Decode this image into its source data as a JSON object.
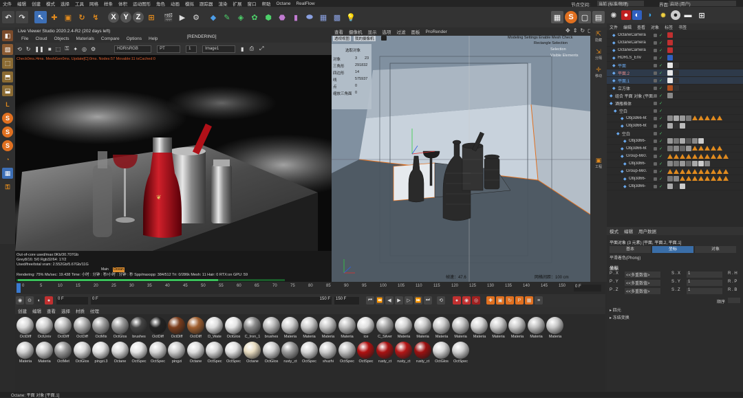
{
  "menubar": {
    "items": [
      "文件",
      "编辑",
      "创建",
      "模式",
      "选择",
      "工具",
      "网格",
      "样条",
      "体积",
      "运动图形",
      "角色",
      "动画",
      "模拟",
      "跟踪器",
      "渲染",
      "扩展",
      "窗口",
      "帮助",
      "Octane",
      "RealFlow"
    ],
    "node_space_label": "节点空间:",
    "node_space_value": "当前 (标准/物理)",
    "layout_label": "界面:",
    "layout_value": "启动 (用户)"
  },
  "toolbar": {
    "axis_x": "X",
    "axis_y": "Y",
    "axis_z": "Z"
  },
  "live_viewer": {
    "title": "Live Viewer Studio 2020.2.4-R2 (202 days left)",
    "menu": [
      "File",
      "Cloud",
      "Objects",
      "Materials",
      "Compare",
      "Options",
      "Help"
    ],
    "state": "[RENDERING]",
    "color_space": "HDR/sRGB",
    "kernel": "PT",
    "index": "1",
    "pass": "Image1",
    "check_line": "Check0ms./4ms. MeshGen0ms. Update[C]:0ms. Nodes:57 Movable:11 txCached:0",
    "status": {
      "line1": "Out-of-core used/max:0Kb/30.707Gb",
      "line2": "Grey8/16: 5/0          Rgb32/64: 17/2",
      "line3": "Used/free/total vram: 2.552Gb/5.67Gb/11G",
      "line4_rendering": "Rendering: 75%  Ms/sec: 19.438  Time: 小时 : 分钟 : 秒/小时 : 分钟 : 秒  Spp/maxspp: 384/512  Tri: 0/286k  Mesh: 11  Hair: 0  RTX:on  GPU: 59",
      "main_label": "Main",
      "main_sub": "Ocean"
    }
  },
  "viewport": {
    "menu": [
      "查看",
      "摄像机",
      "显示",
      "选项",
      "过滤",
      "面板",
      "ProRender"
    ],
    "label_view": "透视视图",
    "label_camera": "我的摄像机",
    "info_top": "Modeling Settings Enable Mesh Check",
    "info_rect": "Rectangle Selection",
    "info_ion": "Selection",
    "info_vis": "Visible Elements",
    "stats_title": "选取对象",
    "stats": [
      {
        "k": "对象",
        "v": "3",
        "v2": "23"
      },
      {
        "k": "三角形",
        "v": "291832"
      },
      {
        "k": "四边形",
        "v": "14"
      },
      {
        "k": "线",
        "v": "575937"
      },
      {
        "k": "点",
        "v": "0"
      },
      {
        "k": "缩放三角面",
        "v": "0"
      }
    ],
    "speed": "帧速：47.6",
    "grid": "网格间距：100 cm"
  },
  "vp_side": {
    "items": [
      "隐藏",
      "分隔",
      "移动",
      "工程"
    ]
  },
  "object_manager": {
    "menu": [
      "文件",
      "编辑",
      "查看",
      "对象",
      "标签",
      "书签"
    ],
    "rows": [
      {
        "name": "OctaneCamera",
        "indent": 8,
        "color": "#cfcfcf"
      },
      {
        "name": "OctaneCamera",
        "indent": 8,
        "color": "#cfcfcf"
      },
      {
        "name": "OctaneCamera",
        "indent": 8,
        "color": "#cfcfcf"
      },
      {
        "name": "HDRLS_Env",
        "indent": 8,
        "color": "#cfcfcf"
      },
      {
        "name": "平面",
        "indent": 8,
        "color": "#6aaaf0"
      },
      {
        "name": "平面.2",
        "indent": 8,
        "color": "#e58c8c"
      },
      {
        "name": "平面.1",
        "indent": 8,
        "color": "#6aaaf0"
      },
      {
        "name": "立方体",
        "indent": 8,
        "color": "#cfcfcf"
      },
      {
        "name": "组合 平面 对象 (平面.1)",
        "indent": 4,
        "color": "#cfcfcf"
      },
      {
        "name": "酒瓶格体",
        "indent": 4,
        "color": "#cfcfcf"
      },
      {
        "name": "空白",
        "indent": 10,
        "color": "#cfcfcf"
      },
      {
        "name": "Obj3d66-6t",
        "indent": 20,
        "color": "#cfcfcf"
      },
      {
        "name": "Obj3d66-6t",
        "indent": 20,
        "color": "#cfcfcf"
      },
      {
        "name": "空白",
        "indent": 14,
        "color": "#cfcfcf"
      },
      {
        "name": "Obj3d66-",
        "indent": 24,
        "color": "#cfcfcf"
      },
      {
        "name": "Obj3d66-6t",
        "indent": 20,
        "color": "#cfcfcf"
      },
      {
        "name": "Group-660.",
        "indent": 20,
        "color": "#cfcfcf"
      },
      {
        "name": "Obj3d66-",
        "indent": 24,
        "color": "#cfcfcf"
      },
      {
        "name": "Group-660.",
        "indent": 20,
        "color": "#cfcfcf"
      },
      {
        "name": "Obj3d66-",
        "indent": 24,
        "color": "#cfcfcf"
      },
      {
        "name": "Obj3d66-",
        "indent": 24,
        "color": "#cfcfcf"
      }
    ]
  },
  "attribute_manager": {
    "menu": [
      "模式",
      "编辑",
      "用户数据"
    ],
    "title": "平面对象 (3 元素) [平面, 平面.2, 平面.1]",
    "tabs": [
      "基本",
      "坐标",
      "对象"
    ],
    "phong": "平滑着色(Phong)",
    "section": "坐标",
    "coords": [
      {
        "a": "P . X",
        "v": "<<多重数值>",
        "b": "S . X",
        "bv": "1",
        "c": "R . H"
      },
      {
        "a": "P . Y",
        "v": "<<多重数值>",
        "b": "S . Y",
        "bv": "1",
        "c": "R . P"
      },
      {
        "a": "P . Z",
        "v": "<<多重数值>",
        "b": "S . Z",
        "bv": "1",
        "c": "R . B"
      }
    ],
    "order": "顺序",
    "quat": "四元",
    "freeze": "冻结变换"
  },
  "timeline": {
    "ticks": [
      "0",
      "5",
      "10",
      "15",
      "20",
      "25",
      "30",
      "35",
      "40",
      "45",
      "50",
      "55",
      "60",
      "65",
      "70",
      "75",
      "80",
      "85",
      "90",
      "95",
      "100",
      "105",
      "110",
      "115",
      "120",
      "125",
      "130",
      "135",
      "140",
      "145",
      "150"
    ],
    "current": "0 F"
  },
  "transport": {
    "start": "0 F",
    "cur": "0 F",
    "end": "150 F",
    "end2": "150 F"
  },
  "material_manager": {
    "menu": [
      "创建",
      "编辑",
      "查看",
      "选择",
      "材质",
      "纹理"
    ],
    "row1": [
      {
        "n": "OctDiff",
        "c": "#d8d8d8"
      },
      {
        "n": "OctUniv",
        "c": "#cfcfcf"
      },
      {
        "n": "OctDiff",
        "c": "#bdbdbd"
      },
      {
        "n": "OctDiff",
        "c": "#b0b0b0"
      },
      {
        "n": "OctMix",
        "c": "#a0a0a0"
      },
      {
        "n": "OctGlos",
        "c": "#9a9a9a"
      },
      {
        "n": "brushes",
        "c": "#444444"
      },
      {
        "n": "OctDiff",
        "c": "#222222"
      },
      {
        "n": "OctDiff",
        "c": "#7b3d1c"
      },
      {
        "n": "OctDiff",
        "c": "#a06030"
      },
      {
        "n": "D_Wate",
        "c": "#dddddd"
      },
      {
        "n": "OctGlos",
        "c": "#e5e5e5"
      },
      {
        "n": "C_Iron_1",
        "c": "#8c8c8c"
      },
      {
        "n": "brushes",
        "c": "#bbbbbb"
      },
      {
        "n": "Materia",
        "c": "#d0d0d0"
      },
      {
        "n": "Materia",
        "c": "#cccccc"
      },
      {
        "n": "Materia",
        "c": "#c4c4c4"
      },
      {
        "n": "Materia",
        "c": "#bcbcbc"
      },
      {
        "n": "ice",
        "c": "#dedede"
      },
      {
        "n": "C_Silver",
        "c": "#a8a8a8"
      },
      {
        "n": "Materia",
        "c": "#d2d2d2"
      },
      {
        "n": "Materia",
        "c": "#c8c8c8"
      },
      {
        "n": "Materia",
        "c": "#cacaca"
      },
      {
        "n": "Materia",
        "c": "#c2c2c2"
      },
      {
        "n": "Materia",
        "c": "#d6d6d6"
      },
      {
        "n": "Materia",
        "c": "#cccccc"
      },
      {
        "n": "Materia",
        "c": "#c8c8c8"
      },
      {
        "n": "Materia",
        "c": "#bebebe"
      },
      {
        "n": "Materia",
        "c": "#c6c6c6"
      }
    ],
    "row2": [
      {
        "n": "Materia",
        "c": "#cfcfcf"
      },
      {
        "n": "Materia",
        "c": "#c8c8c8"
      },
      {
        "n": "OctMet",
        "c": "#999999"
      },
      {
        "n": "OctGlos",
        "c": "#d8d8d8"
      },
      {
        "n": "pingzi.3",
        "c": "#e0e0e0"
      },
      {
        "n": "Octane",
        "c": "#dadada"
      },
      {
        "n": "OctSpec",
        "c": "#e4e4e4"
      },
      {
        "n": "OctSpec",
        "c": "#d4d4d4"
      },
      {
        "n": "pingzi",
        "c": "#cccccc"
      },
      {
        "n": "Octane",
        "c": "#dddddd"
      },
      {
        "n": "OctSpec",
        "c": "#d8d8d8"
      },
      {
        "n": "OctSpec",
        "c": "#e2e2e2"
      },
      {
        "n": "Octane",
        "c": "#e8dcc0"
      },
      {
        "n": "OctGlos",
        "c": "#d0d0d0"
      },
      {
        "n": "rusty_ct",
        "c": "#9a9a9a"
      },
      {
        "n": "OctSpec",
        "c": "#d6d6d6"
      },
      {
        "n": "shuzhi",
        "c": "#cccccc"
      },
      {
        "n": "OctSpec",
        "c": "#c0c0c0"
      },
      {
        "n": "OctSpec",
        "c": "#b01010"
      },
      {
        "n": "rusty_ct",
        "c": "#a81212"
      },
      {
        "n": "rusty_ct",
        "c": "#b41616"
      },
      {
        "n": "rusty_ct",
        "c": "#9c1010"
      },
      {
        "n": "OctGlos",
        "c": "#d6d6d6"
      },
      {
        "n": "OctSpec",
        "c": "#d0d0d0"
      }
    ]
  },
  "statusbar": {
    "text": "Octane:      平面 对象 [平面.1]"
  }
}
